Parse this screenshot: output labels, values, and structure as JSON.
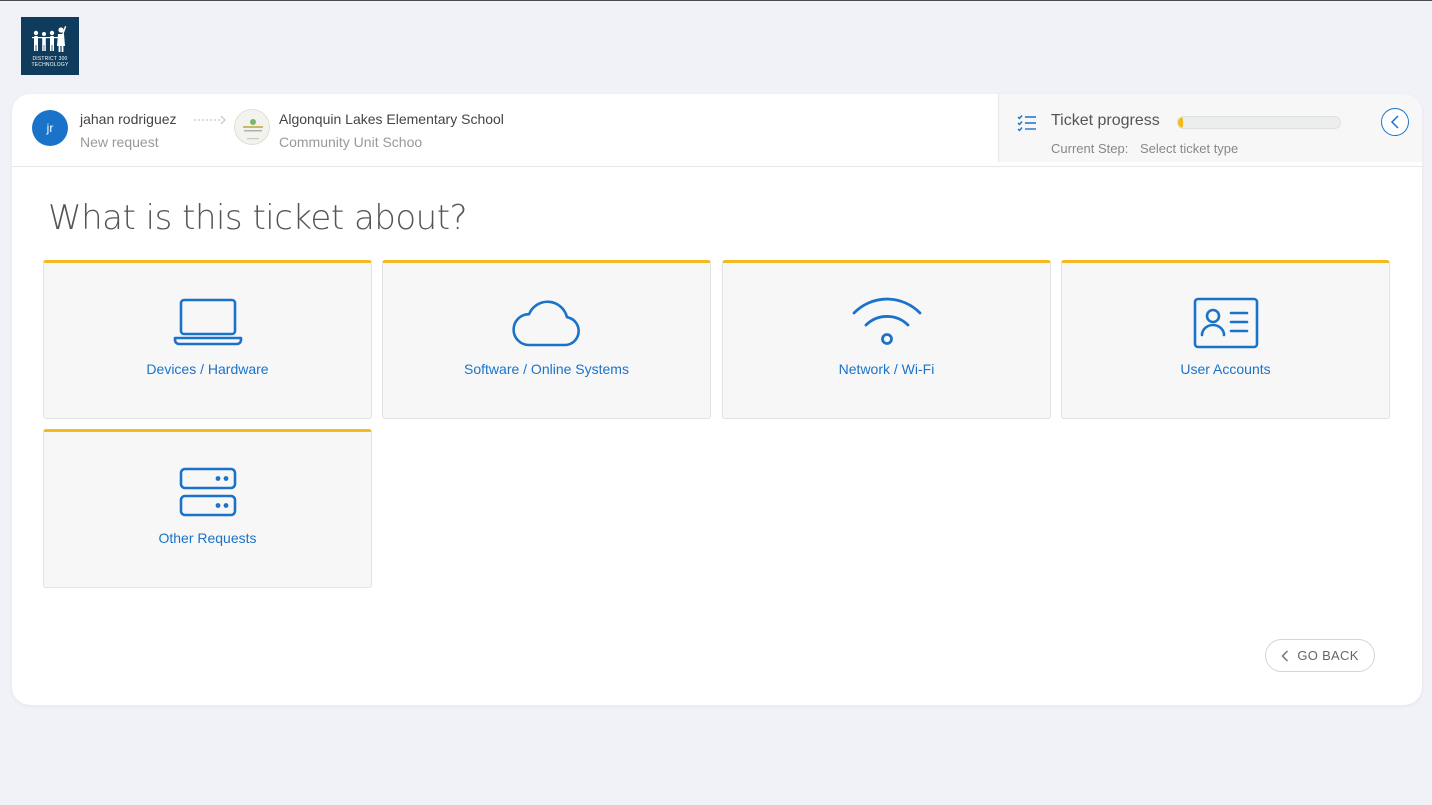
{
  "logo": {
    "text_line1": "DISTRICT 300",
    "text_line2": "TECHNOLOGY"
  },
  "requester": {
    "initials": "jr",
    "name": "jahan rodriguez",
    "subtitle": "New request"
  },
  "location": {
    "name": "Algonquin Lakes Elementary School",
    "subtitle": "Community Unit Schoo"
  },
  "progress": {
    "title": "Ticket progress",
    "percent": 3,
    "step_label": "Current Step:",
    "step_value": "Select ticket type"
  },
  "page": {
    "title": "What is this ticket about?"
  },
  "categories": [
    {
      "label": "Devices / Hardware",
      "icon": "laptop-icon"
    },
    {
      "label": "Software / Online Systems",
      "icon": "cloud-icon"
    },
    {
      "label": "Network / Wi-Fi",
      "icon": "wifi-icon"
    },
    {
      "label": "User Accounts",
      "icon": "id-card-icon"
    },
    {
      "label": "Other Requests",
      "icon": "server-icon"
    }
  ],
  "footer": {
    "go_back_label": "GO BACK"
  },
  "colors": {
    "accent": "#1a73c9",
    "tile_top": "#f3b91e",
    "background": "#f1f2f7"
  }
}
